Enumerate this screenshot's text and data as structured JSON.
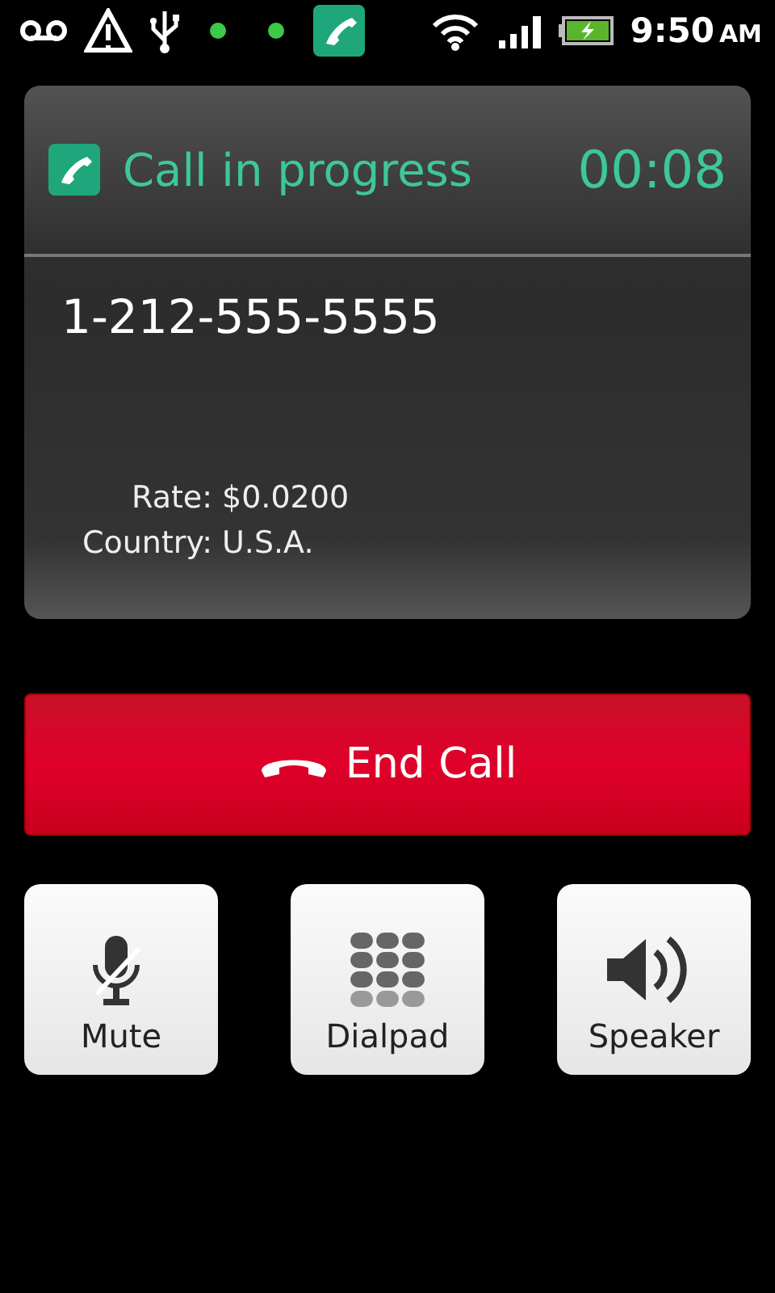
{
  "status_bar": {
    "time": "9:50",
    "meridiem": "AM"
  },
  "call": {
    "title": "Call in progress",
    "timer": "00:08",
    "number": "1-212-555-5555",
    "details": [
      {
        "label": "Rate:",
        "value": "$0.0200"
      },
      {
        "label": "Country:",
        "value": "U.S.A."
      }
    ]
  },
  "end_button": {
    "label": "End Call"
  },
  "buttons": [
    {
      "kind": "mute",
      "label": "Mute"
    },
    {
      "kind": "dialpad",
      "label": "Dialpad"
    },
    {
      "kind": "speaker",
      "label": "Speaker"
    }
  ]
}
